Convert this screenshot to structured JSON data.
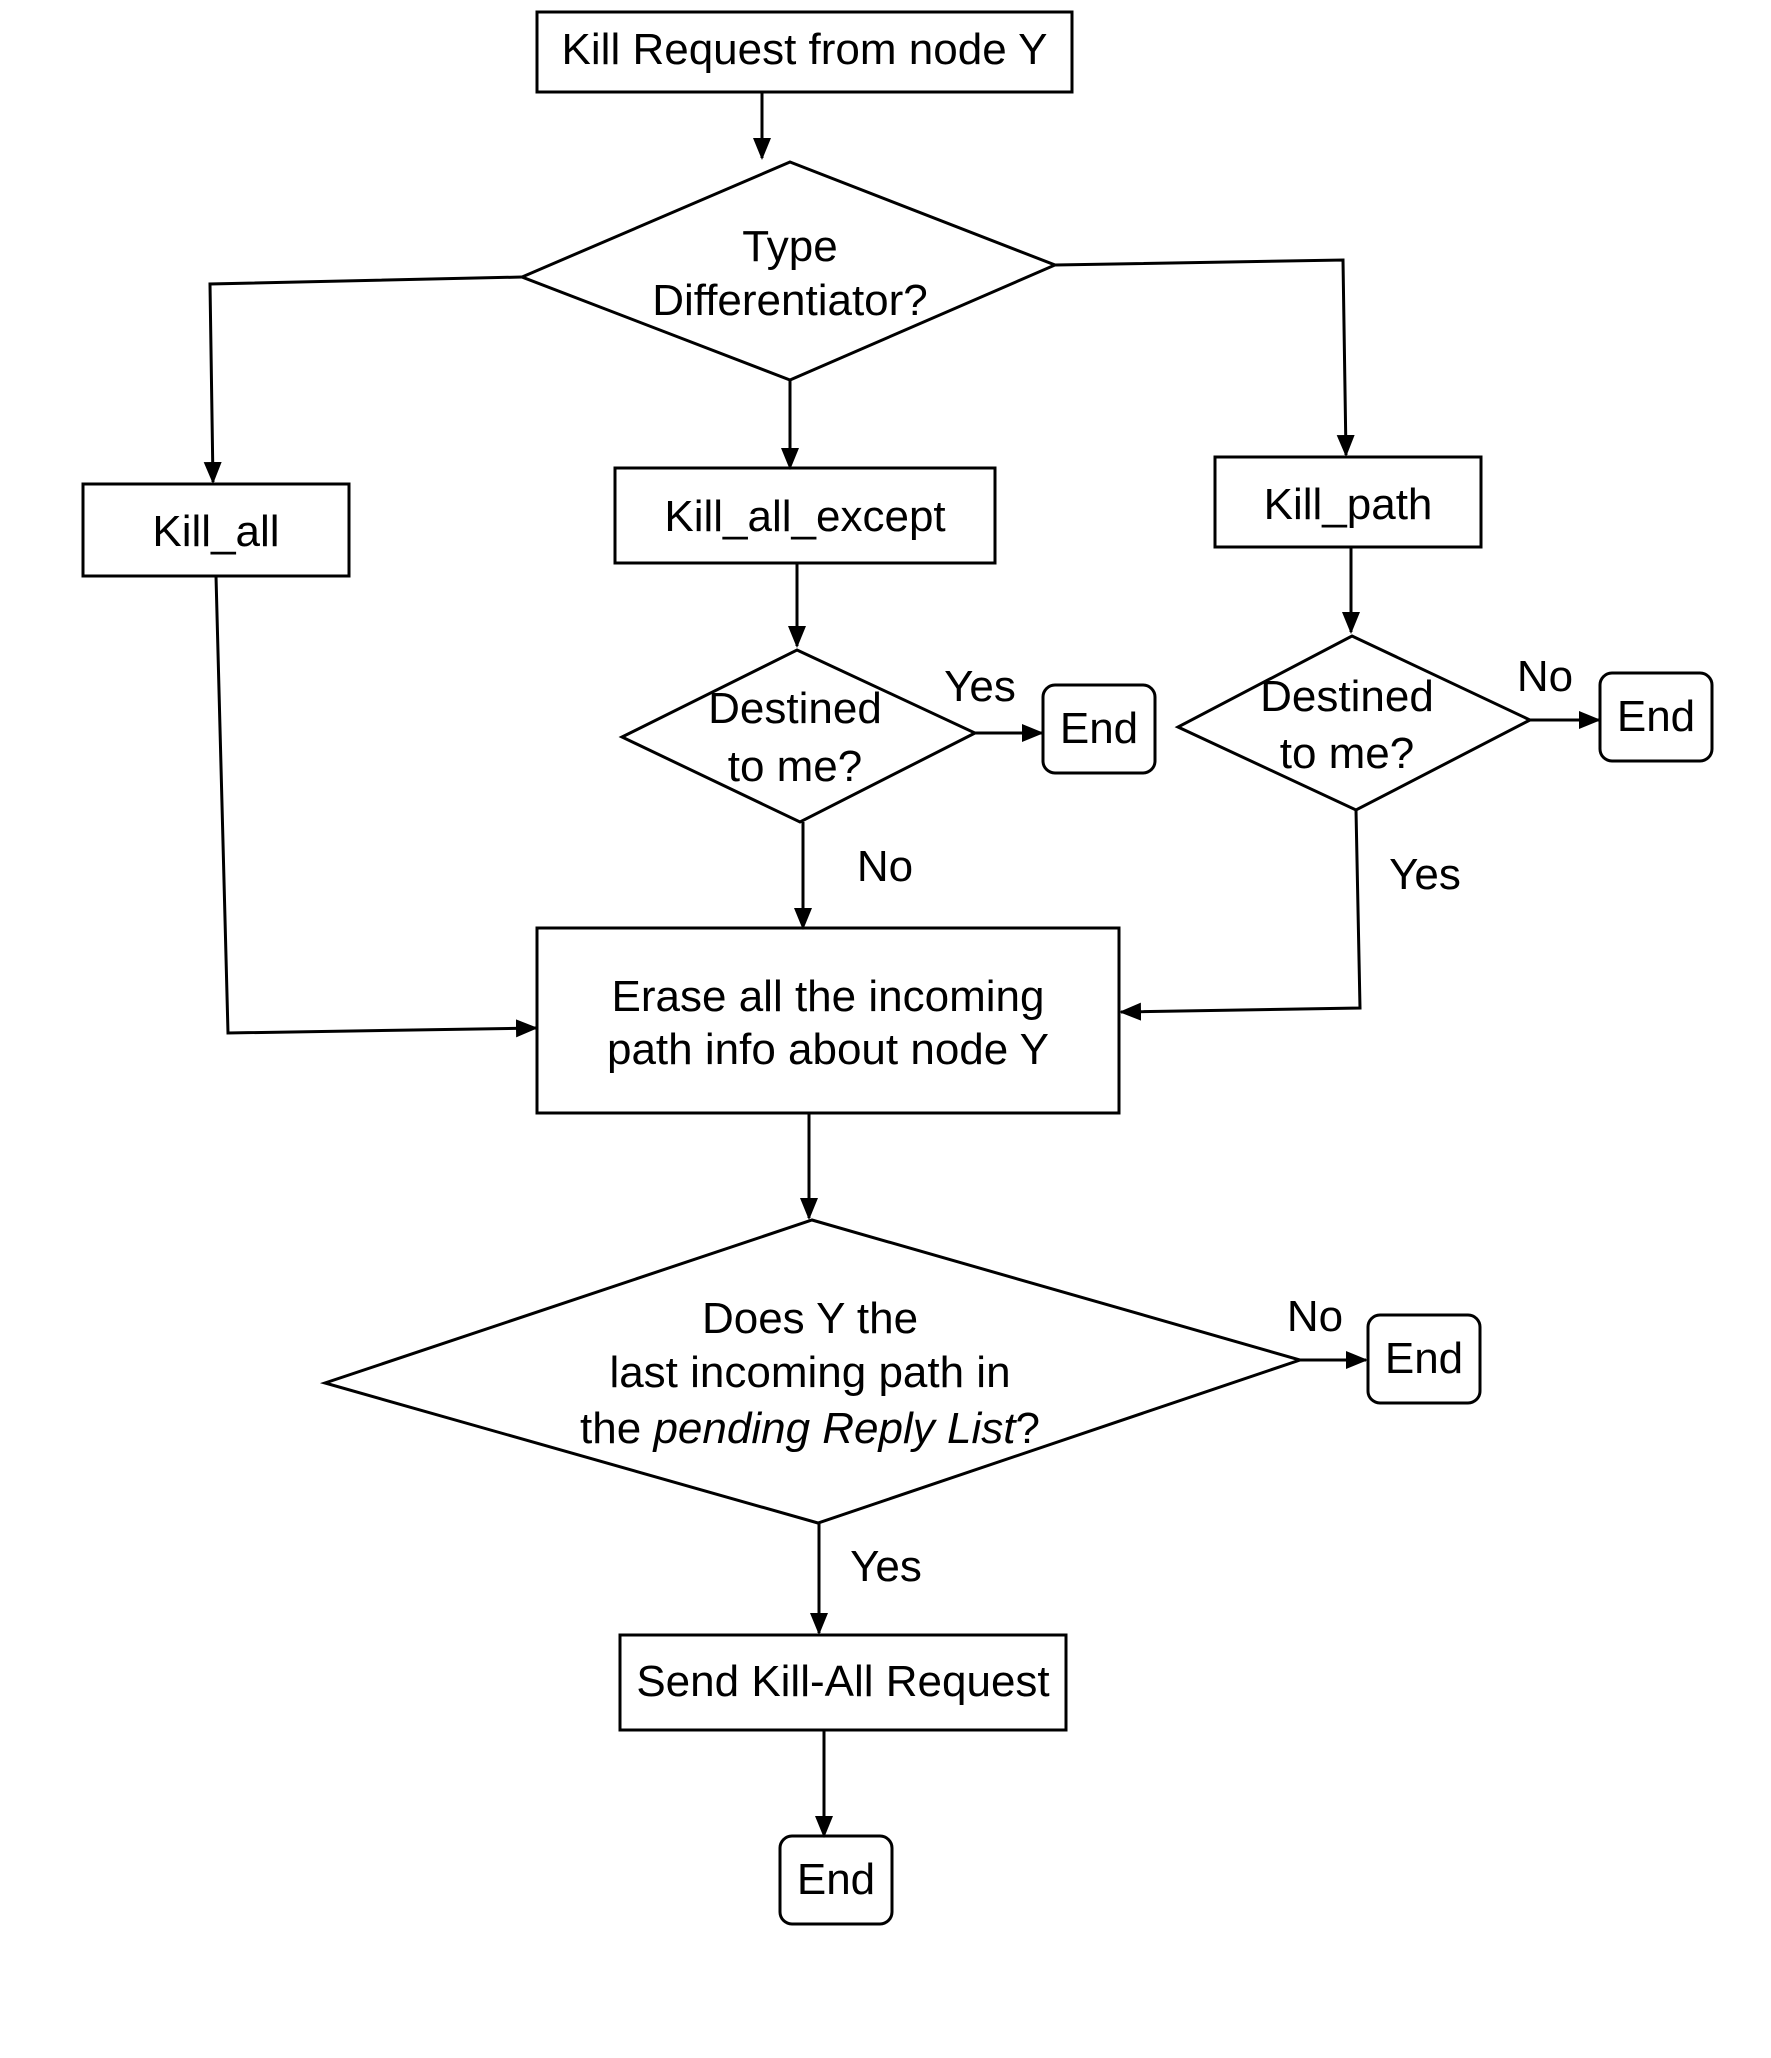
{
  "flowchart": {
    "start": "Kill Request from node Y",
    "type_decision": [
      "Type",
      "Differentiator?"
    ],
    "kill_all": "Kill_all",
    "kill_all_except": "Kill_all_except",
    "kill_path": "Kill_path",
    "destined_mid": [
      "Destined",
      "to me?"
    ],
    "destined_right": [
      "Destined",
      "to me?"
    ],
    "end_label": "End",
    "yes": "Yes",
    "no": "No",
    "erase": [
      "Erase all the incoming",
      "path info about node Y"
    ],
    "last_path": {
      "line1": "Does Y the",
      "line2": "last incoming path in",
      "line3_plain": "the ",
      "line3_italic": "pending Reply List",
      "line3_end": "?"
    },
    "send": "Send Kill-All Request"
  }
}
